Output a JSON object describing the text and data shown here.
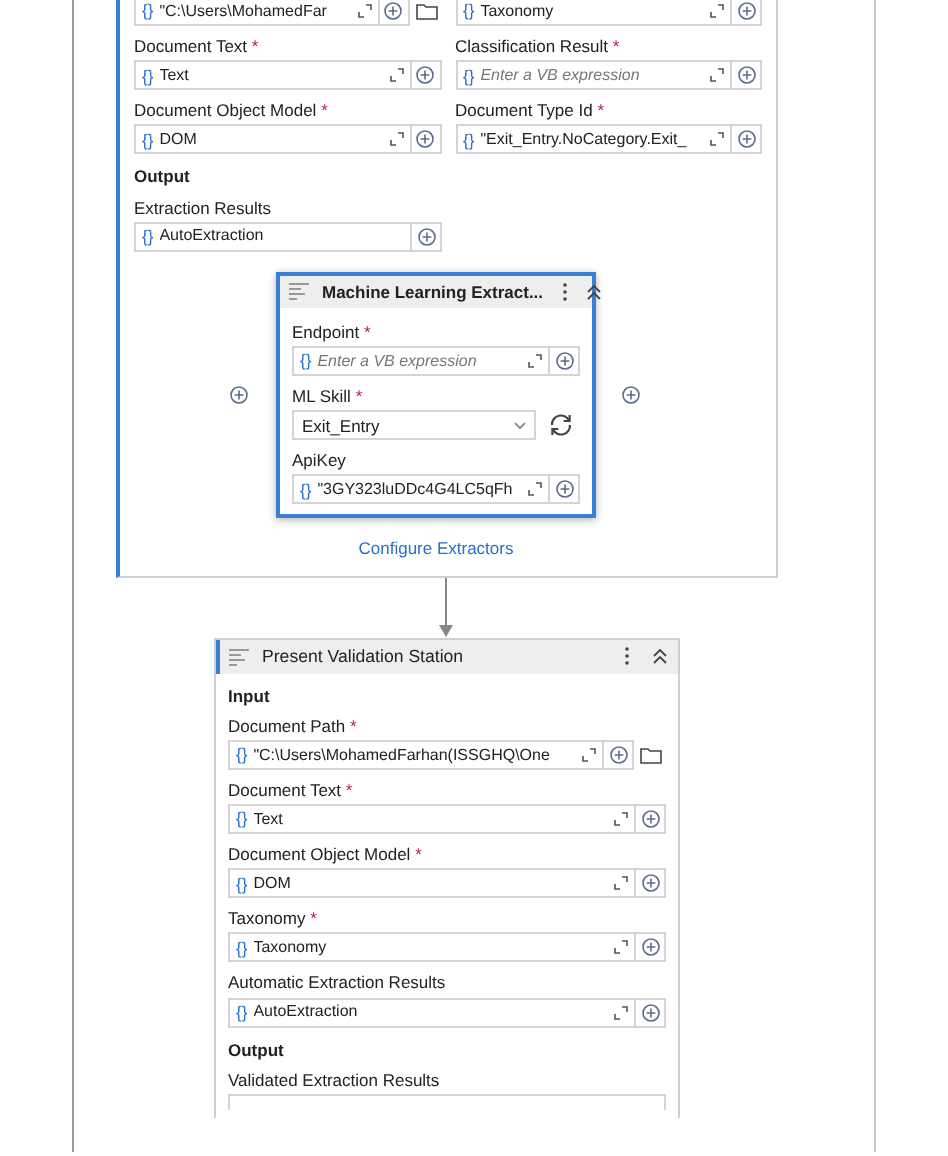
{
  "extract_activity": {
    "items": [
      {
        "kind": "pair",
        "cells": [
          {
            "field": {
              "kind": "path",
              "prefix": "{}",
              "value": "\"C:\\Users\\MohamedFar"
            }
          },
          {
            "field": {
              "kind": "expression",
              "prefix": "{}",
              "value": "Taxonomy"
            }
          }
        ]
      },
      {
        "kind": "pair",
        "cells": [
          {
            "label": "Document Text",
            "asterisk": "*",
            "field": {
              "kind": "expression",
              "prefix": "{}",
              "value": "Text"
            }
          },
          {
            "label": "Classification Result",
            "asterisk": "*",
            "field": {
              "kind": "expression",
              "prefix": "{}",
              "placeholder": "Enter a VB expression"
            }
          }
        ]
      },
      {
        "kind": "pair",
        "cells": [
          {
            "label": "Document Object Model",
            "asterisk": "*",
            "field": {
              "kind": "expression",
              "prefix": "{}",
              "value": "DOM"
            }
          },
          {
            "label": "Document Type Id",
            "asterisk": "*",
            "field": {
              "kind": "expression",
              "prefix": "{}",
              "value": "\"Exit_Entry.NoCategory.Exit_"
            }
          }
        ]
      },
      {
        "kind": "heading",
        "text": "Output"
      },
      {
        "kind": "single",
        "label": "Extraction Results",
        "field": {
          "kind": "output",
          "prefix": "{}",
          "value": "AutoExtraction"
        }
      }
    ],
    "extractor": {
      "title": "Machine Learning Extract...",
      "selected": true,
      "items": [
        {
          "kind": "single",
          "label": "Endpoint",
          "asterisk": "*",
          "field": {
            "kind": "expression",
            "prefix": "{}",
            "placeholder": "Enter a VB expression"
          }
        },
        {
          "kind": "single",
          "label": "ML Skill",
          "asterisk": "*",
          "field": {
            "kind": "select",
            "value": "Exit_Entry"
          }
        },
        {
          "kind": "single",
          "label": "ApiKey",
          "field": {
            "kind": "expression",
            "prefix": "{}",
            "value": "\"3GY323luDDc4G4LC5qFh"
          }
        }
      ]
    },
    "link": "Configure Extractors"
  },
  "validation_activity": {
    "title": "Present Validation Station",
    "items": [
      {
        "kind": "heading",
        "text": "Input"
      },
      {
        "kind": "single",
        "label": "Document Path",
        "asterisk": "*",
        "field": {
          "kind": "path",
          "prefix": "{}",
          "value": "\"C:\\Users\\MohamedFarhan(ISSGHQ\\One"
        }
      },
      {
        "kind": "single",
        "label": "Document Text",
        "asterisk": "*",
        "field": {
          "kind": "expression",
          "prefix": "{}",
          "value": "Text"
        }
      },
      {
        "kind": "single",
        "label": "Document Object Model",
        "asterisk": "*",
        "field": {
          "kind": "expression",
          "prefix": "{}",
          "value": "DOM"
        }
      },
      {
        "kind": "single",
        "label": "Taxonomy",
        "asterisk": "*",
        "field": {
          "kind": "expression",
          "prefix": "{}",
          "value": "Taxonomy"
        }
      },
      {
        "kind": "single",
        "label": "Automatic Extraction Results",
        "field": {
          "kind": "expression",
          "prefix": "{}",
          "value": "AutoExtraction"
        }
      },
      {
        "kind": "heading",
        "text": "Output"
      },
      {
        "kind": "single",
        "label": "Validated Extraction Results",
        "field": {
          "kind": "cut"
        }
      }
    ]
  }
}
